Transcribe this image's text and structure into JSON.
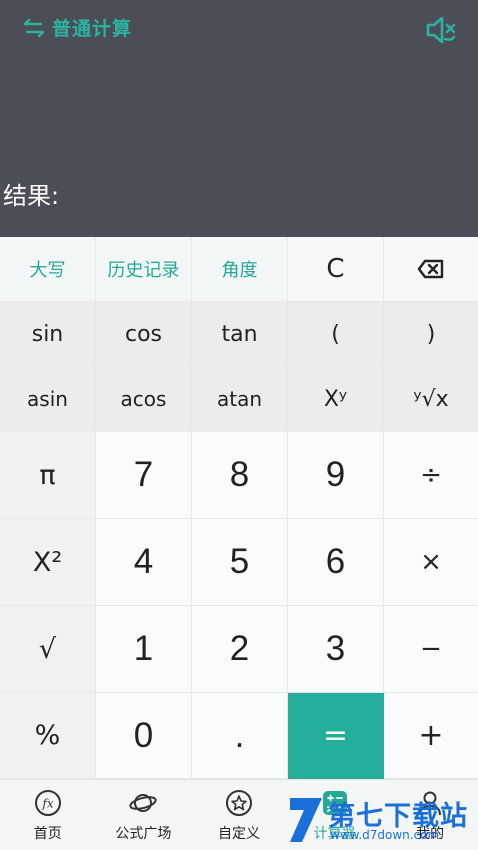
{
  "header": {
    "mode_label": "普通计算",
    "mode_icon": "swap-arrows-icon",
    "sound_icon": "speaker-mute-icon",
    "accent_color": "#2bb3a0",
    "display_bg": "#4b4d57"
  },
  "display": {
    "result_label": "结果:"
  },
  "keypad": {
    "rows": [
      [
        "大写",
        "历史记录",
        "角度",
        "C",
        "⌫"
      ],
      [
        "sin",
        "cos",
        "tan",
        "(",
        ")"
      ],
      [
        "asin",
        "acos",
        "atan",
        "Xʸ",
        "ʸ√x"
      ],
      [
        "π",
        "7",
        "8",
        "9",
        "÷"
      ],
      [
        "X²",
        "4",
        "5",
        "6",
        "×"
      ],
      [
        "√",
        "1",
        "2",
        "3",
        "−"
      ],
      [
        "%",
        "0",
        ".",
        "=",
        "+"
      ]
    ],
    "equals_color": "#26ae9c"
  },
  "tabbar": {
    "items": [
      {
        "label": "首页",
        "icon": "fx-icon"
      },
      {
        "label": "公式广场",
        "icon": "planet-icon"
      },
      {
        "label": "自定义",
        "icon": "star-circle-icon"
      },
      {
        "label": "计算器",
        "icon": "calculator-icon"
      },
      {
        "label": "我的",
        "icon": "person-icon"
      }
    ],
    "active_index": 3
  },
  "watermark": {
    "title": "第七下载站",
    "url": "www.d7down.com"
  }
}
